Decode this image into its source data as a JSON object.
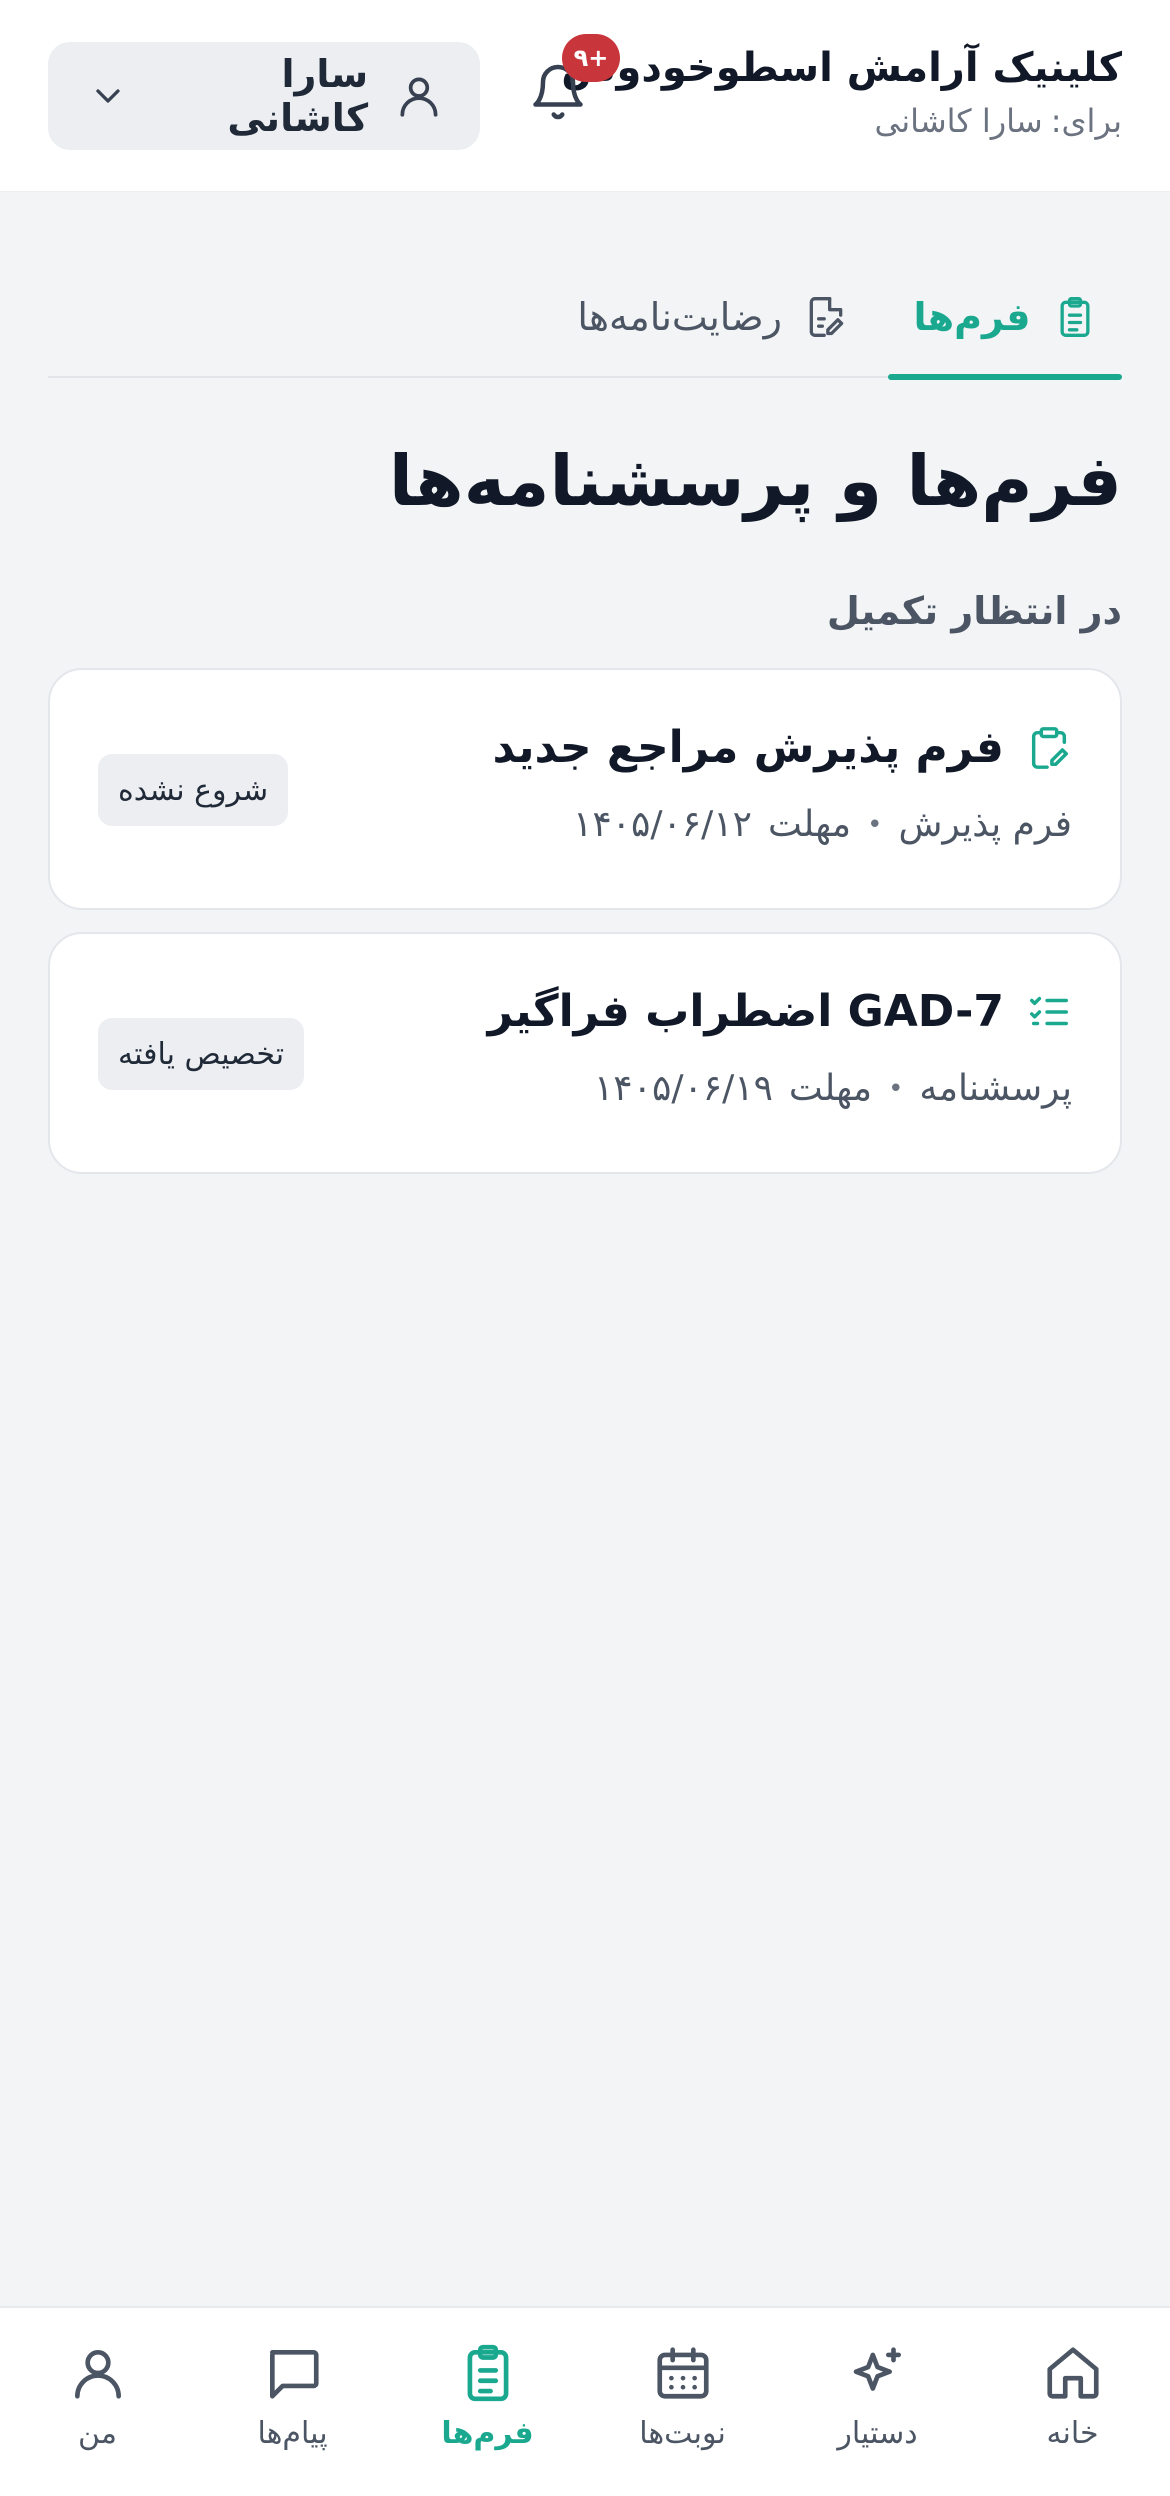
{
  "colors": {
    "accent": "#1aa88f",
    "badge_red": "#c8363b",
    "page_bg": "#f3f4f6"
  },
  "header": {
    "clinic_name": "کلینیک آرامش اسطوخودوس",
    "for_prefix": "برای:",
    "for_name": "سارا کاشانی",
    "notification_count": "۹+",
    "user_name": "سارا کاشانی"
  },
  "tabs": {
    "forms": {
      "label": "فرم‌ها",
      "icon": "clipboard-list-icon",
      "active": true
    },
    "consents": {
      "label": "رضایت‌نامه‌ها",
      "icon": "file-signature-icon",
      "active": false
    }
  },
  "page_title": "فرم‌ها و پرسشنامه‌ها",
  "section_label": "در انتظار تکمیل",
  "cards": [
    {
      "title": "فرم پذیرش مراجع جدید",
      "icon": "clipboard-edit-icon",
      "type": "فرم پذیرش",
      "due_label": "مهلت",
      "due_date": "۱۴۰۵/۰۶/۱۲",
      "status": "شروع نشده"
    },
    {
      "title": "GAD-7 اضطراب فراگیر",
      "icon": "checklist-icon",
      "type": "پرسشنامه",
      "due_label": "مهلت",
      "due_date": "۱۴۰۵/۰۶/۱۹",
      "status": "تخصیص یافته"
    }
  ],
  "nav": {
    "home": {
      "label": "خانه",
      "icon": "home-icon"
    },
    "assistant": {
      "label": "دستیار",
      "icon": "sparkle-icon"
    },
    "appointments": {
      "label": "نوبت‌ها",
      "icon": "calendar-icon"
    },
    "forms": {
      "label": "فرم‌ها",
      "icon": "clipboard-list-icon",
      "active": true
    },
    "messages": {
      "label": "پیام‌ها",
      "icon": "message-icon"
    },
    "me": {
      "label": "من",
      "icon": "user-icon"
    }
  }
}
